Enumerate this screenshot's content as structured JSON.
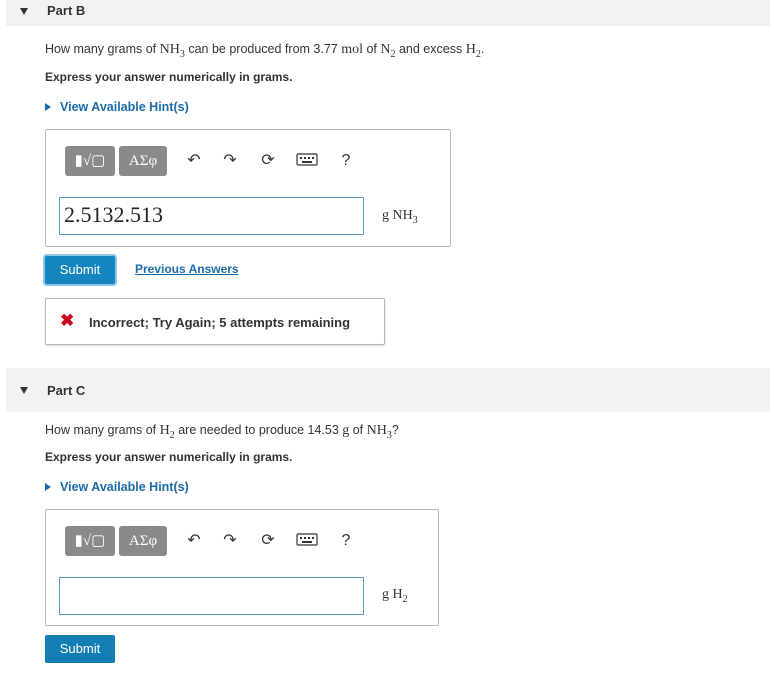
{
  "part_b": {
    "title": "Part B",
    "question_parts": [
      "How many grams of ",
      "NH",
      "3",
      " can be produced from 3.77 ",
      "mol",
      " of ",
      "N",
      "2",
      " and excess ",
      "H",
      "2",
      "."
    ],
    "instruction": "Express your answer numerically in grams.",
    "hint_label": "View Available Hint(s)",
    "toolbar": {
      "templates_label": "▮√▢",
      "greek_label": "ΑΣφ",
      "help_label": "?"
    },
    "input_value": "2.5132.513",
    "unit": {
      "base": "g NH",
      "sub": "3"
    },
    "submit_label": "Submit",
    "previous_answers_label": "Previous Answers",
    "feedback": {
      "icon": "✖",
      "message": "Incorrect; Try Again; 5 attempts remaining"
    }
  },
  "part_c": {
    "title": "Part C",
    "question_parts": [
      "How many grams of ",
      "H",
      "2",
      " are needed to produce 14.53 ",
      "g",
      " of ",
      "NH",
      "3",
      "?"
    ],
    "instruction": "Express your answer numerically in grams.",
    "hint_label": "View Available Hint(s)",
    "toolbar": {
      "templates_label": "▮√▢",
      "greek_label": "ΑΣφ",
      "help_label": "?"
    },
    "input_value": "",
    "unit": {
      "base": "g H",
      "sub": "2"
    },
    "submit_label": "Submit"
  },
  "colors": {
    "accent": "#137eb3",
    "link": "#1a6ca8",
    "error": "#d0021b",
    "toolbar_button": "#8a8a8a"
  }
}
